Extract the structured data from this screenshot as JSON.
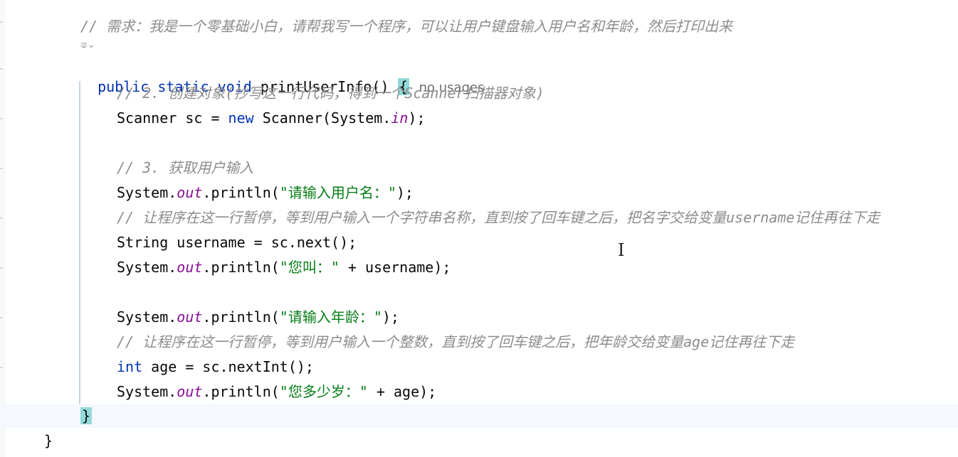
{
  "editor": {
    "header_comment": "// 需求：我是一个零基础小白，请帮我写一个程序，可以让用户键盘输入用户名和年龄，然后打印出来",
    "author_hint": "ෂ⌄",
    "method": {
      "kw_public": "public",
      "kw_static": "static",
      "kw_void": "void",
      "name": " printUserInfo() ",
      "open_brace": "{",
      "usages_hint": "no usages"
    },
    "comment_2": "// 2. 创建对象(抄写这一行代码，得到一个Scanner扫描器对象)",
    "scanner_line": {
      "pre": "Scanner sc = ",
      "kw_new": "new",
      "mid": " Scanner(System.",
      "field_in": "in",
      "post": ");"
    },
    "comment_3": "// 3. 获取用户输入",
    "println_user_prompt": {
      "pre": "System.",
      "out": "out",
      "mid": ".println(",
      "str": "\"请输入用户名：\"",
      "post": ");"
    },
    "comment_wait_name": "// 让程序在这一行暂停，等到用户输入一个字符串名称，直到按了回车键之后，把名字交给变量username记住再往下走",
    "username_line": "String username = sc.next();",
    "println_you_called": {
      "pre": "System.",
      "out": "out",
      "mid": ".println(",
      "str": "\"您叫：\"",
      "post": " + username);"
    },
    "println_age_prompt": {
      "pre": "System.",
      "out": "out",
      "mid": ".println(",
      "str": "\"请输入年龄：\"",
      "post": ");"
    },
    "comment_wait_age": "// 让程序在这一行暂停，等到用户输入一个整数，直到按了回车键之后，把年龄交给变量age记住再往下走",
    "age_line": {
      "kw_int": "int",
      "rest": " age = sc.nextInt();"
    },
    "println_age": {
      "pre": "System.",
      "out": "out",
      "mid": ".println(",
      "str": "\"您多少岁：\"",
      "post": " + age);"
    },
    "close_brace_method": "}",
    "close_brace_class": "}",
    "cursor_glyph": "I"
  },
  "colors": {
    "keyword": "#0033b3",
    "string": "#067d17",
    "comment": "#8c8c8c",
    "static_field": "#871094",
    "brace_highlight": "#93d9d9"
  }
}
